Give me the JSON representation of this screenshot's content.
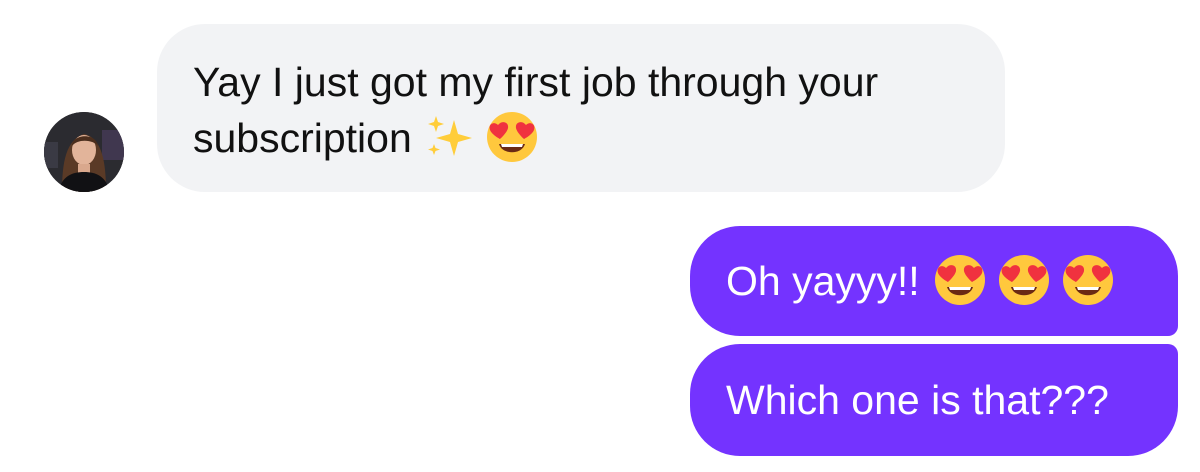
{
  "colors": {
    "incoming_bubble": "#f2f3f5",
    "outgoing_bubble": "#7433ff",
    "incoming_text": "#111111",
    "outgoing_text": "#ffffff"
  },
  "conversation": {
    "incoming": [
      {
        "line1": "Yay I just got my first job through your",
        "line2": "subscription",
        "emojis": [
          "sparkles-emoji",
          "heart-eyes-emoji"
        ]
      }
    ],
    "outgoing": [
      {
        "text": "Oh yayyy!!",
        "emojis": [
          "heart-eyes-emoji",
          "heart-eyes-emoji",
          "heart-eyes-emoji"
        ]
      },
      {
        "text": "Which one is that???"
      }
    ]
  }
}
